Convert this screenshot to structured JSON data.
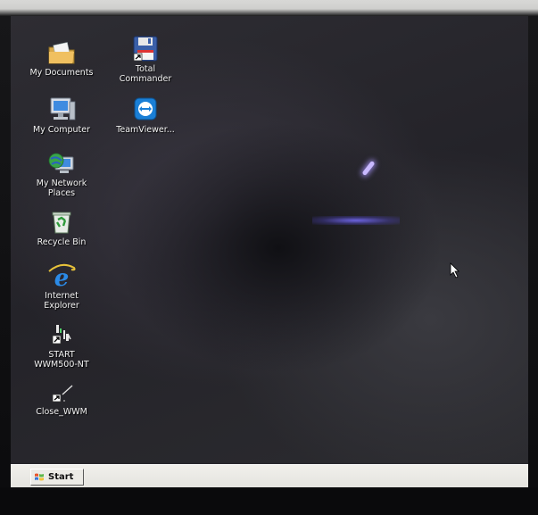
{
  "desktop": {
    "icons": [
      {
        "name": "my-documents",
        "label": "My Documents",
        "icon": "folder-documents-icon"
      },
      {
        "name": "total-commander",
        "label": "Total\nCommander",
        "icon": "floppy-disk-icon"
      },
      {
        "name": "my-computer",
        "label": "My Computer",
        "icon": "computer-monitor-icon"
      },
      {
        "name": "teamviewer",
        "label": "TeamViewer...",
        "icon": "teamviewer-icon"
      },
      {
        "name": "my-network-places",
        "label": "My Network\nPlaces",
        "icon": "network-globe-icon"
      },
      {
        "name": "recycle-bin",
        "label": "Recycle Bin",
        "icon": "recycle-bin-icon"
      },
      {
        "name": "internet-explorer",
        "label": "Internet\nExplorer",
        "icon": "internet-explorer-icon"
      },
      {
        "name": "start-wwm500-nt",
        "label": "START\nWWM500-NT",
        "icon": "shortcut-app-icon"
      },
      {
        "name": "close-wwm",
        "label": "Close_WWM",
        "icon": "shortcut-close-icon"
      }
    ]
  },
  "taskbar": {
    "start_label": "Start",
    "start_icon": "windows-flag-icon"
  },
  "colors": {
    "desktop_bg": "#2a292f",
    "taskbar_bg": "#ecebe6",
    "icon_label": "#f2f2f2"
  }
}
